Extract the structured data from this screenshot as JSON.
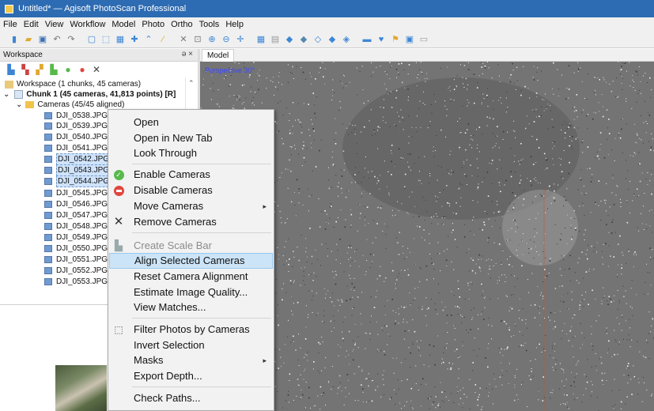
{
  "window": {
    "title": "Untitled* — Agisoft PhotoScan Professional"
  },
  "menu": [
    "File",
    "Edit",
    "View",
    "Workflow",
    "Model",
    "Photo",
    "Ortho",
    "Tools",
    "Help"
  ],
  "workspace": {
    "header": "Workspace",
    "controls": "ə ×",
    "root": "Workspace (1 chunks, 45 cameras)",
    "chunk": "Chunk 1 (45 cameras, 41,813 points) [R]",
    "cameras_folder": "Cameras (45/45 aligned)",
    "cameras": [
      "DJI_0538.JPG",
      "DJI_0539.JPG",
      "DJI_0540.JPG",
      "DJI_0541.JPG",
      "DJI_0542.JPG NA",
      "DJI_0543.JPG NA",
      "DJI_0544.JPG NA",
      "DJI_0545.JPG",
      "DJI_0546.JPG",
      "DJI_0547.JPG",
      "DJI_0548.JPG",
      "DJI_0549.JPG",
      "DJI_0550.JPG",
      "DJI_0551.JPG",
      "DJI_0552.JPG",
      "DJI_0553.JPG"
    ]
  },
  "model_tab": {
    "label": "Model",
    "projection": "Perspective 30°"
  },
  "context_menu": {
    "items": [
      {
        "label": "Open"
      },
      {
        "label": "Open in New Tab"
      },
      {
        "label": "Look Through"
      },
      {
        "label": "Enable Cameras",
        "icon": "check-circle-icon"
      },
      {
        "label": "Disable Cameras",
        "icon": "minus-circle-icon"
      },
      {
        "label": "Move Cameras",
        "submenu": "▸"
      },
      {
        "label": "Remove Cameras",
        "icon": "x-icon"
      },
      {
        "label": "Create Scale Bar",
        "icon": "scale-bar-icon",
        "disabled": true
      },
      {
        "label": "Align Selected Cameras",
        "highlighted": true
      },
      {
        "label": "Reset Camera Alignment"
      },
      {
        "label": "Estimate Image Quality..."
      },
      {
        "label": "View Matches..."
      },
      {
        "label": "Filter Photos by Cameras",
        "icon": "filter-photos-icon"
      },
      {
        "label": "Invert Selection"
      },
      {
        "label": "Masks",
        "submenu": "▸"
      },
      {
        "label": "Export Depth..."
      },
      {
        "label": "Check Paths..."
      }
    ]
  },
  "colors": {
    "titlebar": "#2d6bb2",
    "viewport_bg": "#747474",
    "menu_highlight": "#cce4f7",
    "projection_text": "#3c47ff"
  }
}
